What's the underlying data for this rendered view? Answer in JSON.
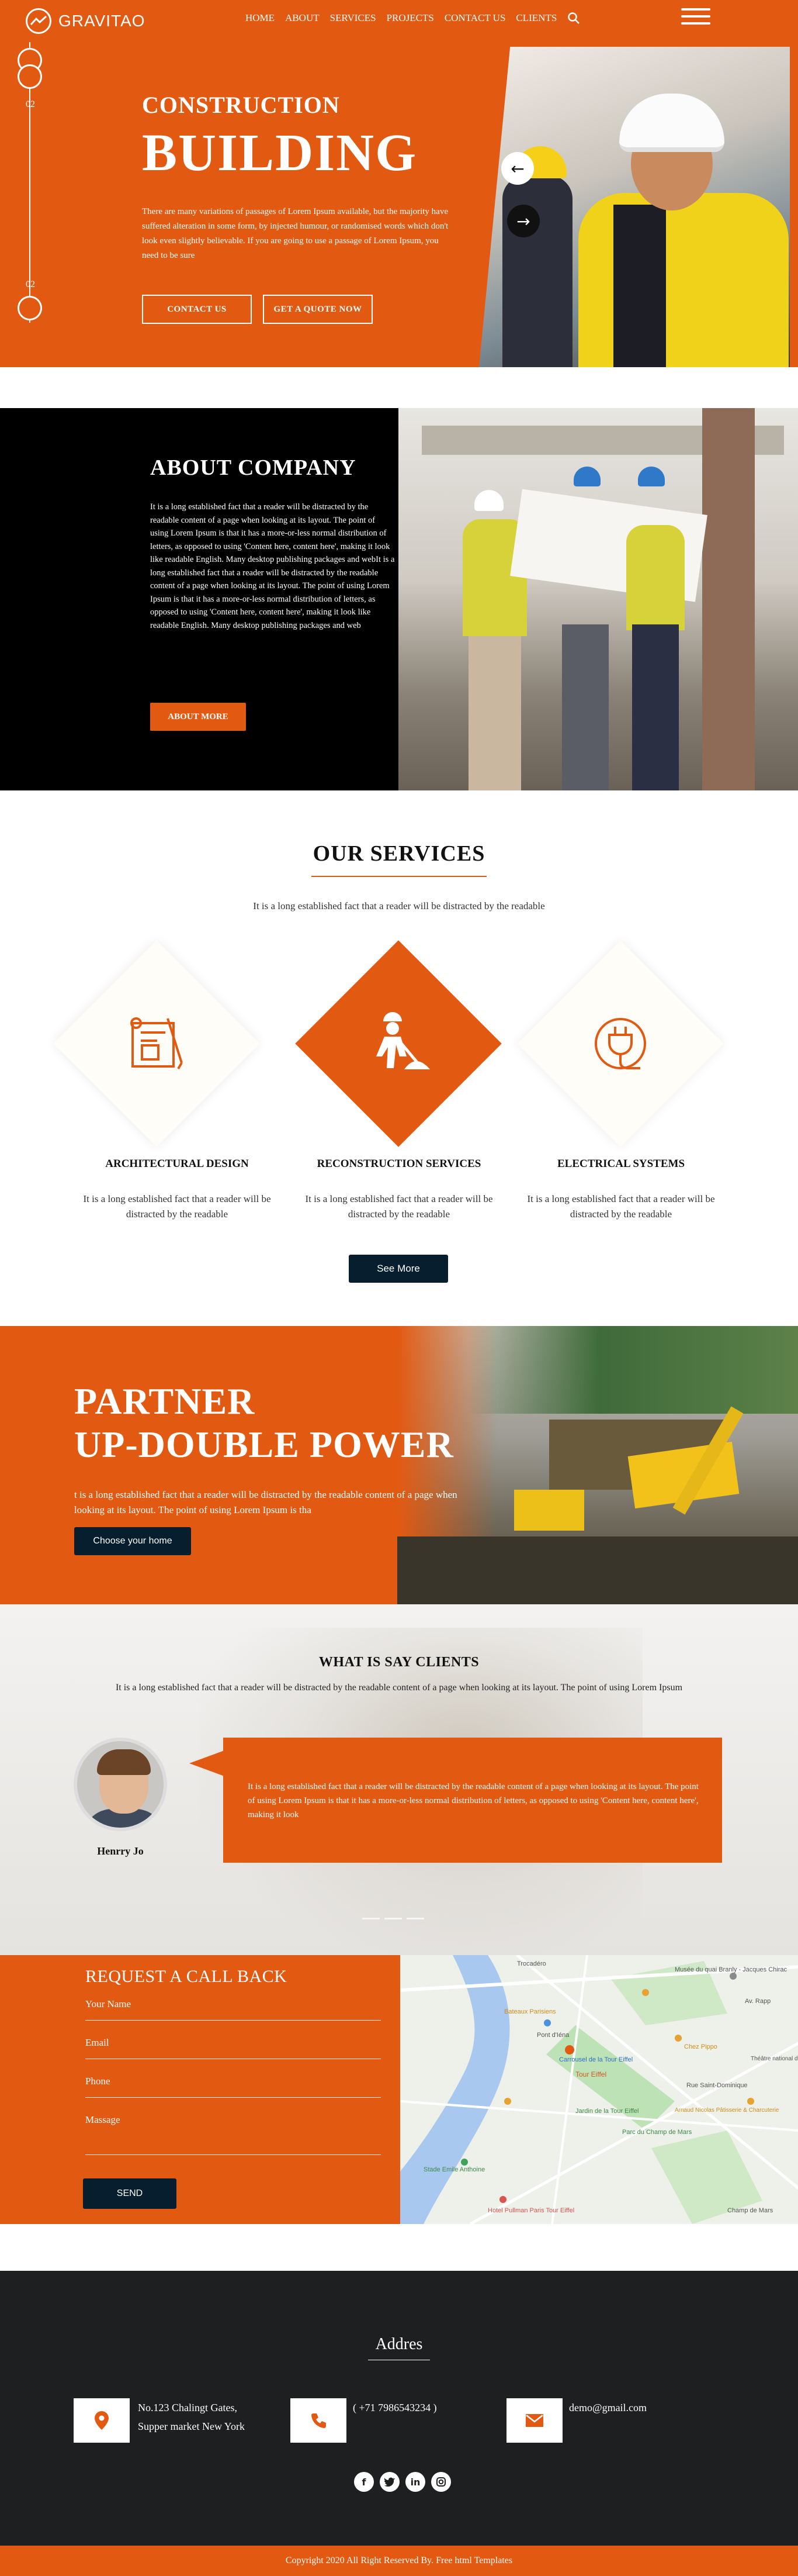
{
  "brand": {
    "name": "GRAVITAO",
    "accent": "#e25a12",
    "dark": "#071e2e"
  },
  "nav": {
    "items": [
      "HOME",
      "ABOUT",
      "SERVICES",
      "PROJECTS",
      "CONTACT US",
      "CLIENTS"
    ],
    "search_icon": "search-icon",
    "menu_icon": "hamburger-icon"
  },
  "hero": {
    "slide_top": "02",
    "slide_bottom": "02",
    "subtitle": "CONSTRUCTION",
    "title": "BUILDING",
    "text": "There are many variations of passages of Lorem Ipsum available, but the majority have suffered alteration in some form, by injected humour, or randomised words which don't look even slightly believable. If you are going to use a passage of Lorem Ipsum, you need to be sure",
    "btn_contact": "CONTACT US",
    "btn_quote": "GET A QUOTE NOW",
    "prev_icon": "arrow-left-icon",
    "next_icon": "arrow-right-icon"
  },
  "about": {
    "title": "ABOUT COMPANY",
    "text": "It is a long established fact that a reader will be distracted by the readable content of a page when looking at its layout. The point of using Lorem Ipsum is that it has a more-or-less normal distribution of letters, as opposed to using 'Content here, content here', making it look like readable English. Many desktop publishing packages and webIt is a long established fact that a reader will be distracted by the readable content of a page when looking at its layout. The point of using Lorem Ipsum is that it has a more-or-less normal distribution of letters, as opposed to using 'Content here, content here', making it look like readable English. Many desktop publishing packages and web",
    "button": "ABOUT MORE"
  },
  "services": {
    "title": "OUR SERVICES",
    "subtitle": "It is a long established fact that a reader will be distracted by the readable",
    "items": [
      {
        "title": "ARCHITECTURAL DESIGN",
        "text": "It is a long established fact that a reader will be distracted by the readable",
        "icon": "blueprint-icon"
      },
      {
        "title": "RECONSTRUCTION SERVICES",
        "text": "It is a long established fact that a reader will be distracted by the readable",
        "icon": "worker-shovel-icon"
      },
      {
        "title": "ELECTRICAL SYSTEMS",
        "text": "It is a long established fact that a reader will be distracted by the readable",
        "icon": "electric-plug-icon"
      }
    ],
    "button": "See More"
  },
  "partner": {
    "title_line1": "PARTNER",
    "title_line2": "UP-DOUBLE POWER",
    "text": "t is a long established fact that a reader will be distracted by the readable content of a page when looking at its layout. The point of using Lorem Ipsum is tha",
    "button": "Choose your home"
  },
  "clients": {
    "title": "WHAT IS SAY CLIENTS",
    "subtitle": "It is a long established fact that a reader will be distracted by the readable content of a page when looking at its layout. The point of using Lorem Ipsum",
    "name": "Henrry Jo",
    "quote": "It is a long established fact that a reader will be distracted by the readable content of a page when looking at its layout. The point of using Lorem Ipsum is that it has a more-or-less normal distribution of letters, as opposed to using 'Content here, content here', making it look"
  },
  "contact": {
    "title": "REQUEST A CALL BACK",
    "fields": [
      "Your Name",
      "Email",
      "Phone",
      "Massage"
    ],
    "button": "SEND",
    "map_labels": [
      "Trocadéro",
      "Musée du quai Branly - Jacques Chirac",
      "Av. Rapp",
      "Bateaux Parisiens",
      "Pont d'Iéna",
      "Carrousel de la Tour Eiffel",
      "Tour Eiffel",
      "Chez Pippo",
      "Théâtre national de Chaillot",
      "Rue Saint-Dominique",
      "Parc du Champ de Mars",
      "Jardin de la Tour Eiffel",
      "Arnaud Nicolas Pâtisserie & Charcuterie",
      "Hotel Pullman Paris Tour Eiffel",
      "Stade Emile Anthoine",
      "Champ de Mars"
    ]
  },
  "footer": {
    "title": "Addres",
    "address": "No.123 Chalingt Gates,\nSupper market New York",
    "phone": "( +71 7986543234 )",
    "email": "demo@gmail.com",
    "icons": [
      "location-pin-icon",
      "phone-icon",
      "mail-icon"
    ],
    "social": [
      "facebook-icon",
      "twitter-icon",
      "linkedin-icon",
      "instagram-icon"
    ],
    "copyright": "Copyright 2020 All Right Reserved By. Free html Templates"
  }
}
